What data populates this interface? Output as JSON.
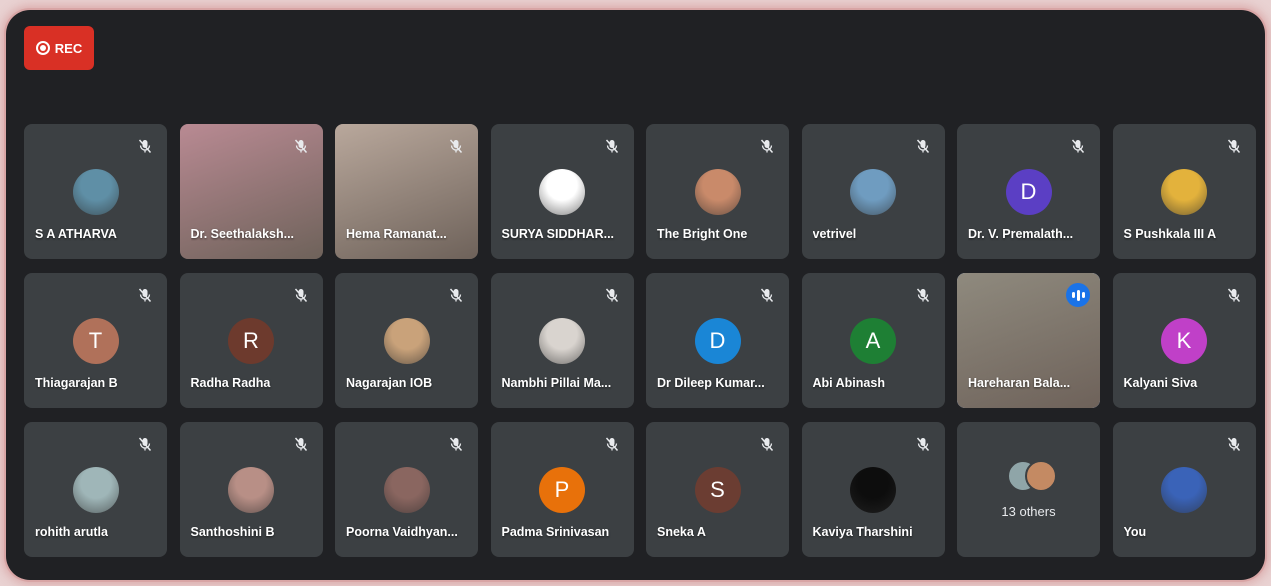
{
  "recording": {
    "label": "REC"
  },
  "participants": [
    {
      "name": "S A ATHARVA",
      "kind": "photo",
      "bg": "#5f8fa6"
    },
    {
      "name": "Dr. Seethalaksh...",
      "kind": "video",
      "bg": "#b98a93"
    },
    {
      "name": "Hema Ramanat...",
      "kind": "video",
      "bg": "#b9a89c"
    },
    {
      "name": "SURYA SIDDHAR...",
      "kind": "photo",
      "bg": "#ffffff"
    },
    {
      "name": "The Bright One",
      "kind": "photo",
      "bg": "#c98a6a"
    },
    {
      "name": "vetrivel",
      "kind": "photo",
      "bg": "#6f9cc0"
    },
    {
      "name": "Dr. V. Premalath...",
      "kind": "initial",
      "initial": "D",
      "bg": "#5b3fc4"
    },
    {
      "name": "S Pushkala III A",
      "kind": "photo",
      "bg": "#e3b23c"
    },
    {
      "name": "Thiagarajan B",
      "kind": "initial",
      "initial": "T",
      "bg": "#b0715a"
    },
    {
      "name": "Radha Radha",
      "kind": "initial",
      "initial": "R",
      "bg": "#6d3a2d"
    },
    {
      "name": "Nagarajan IOB",
      "kind": "photo",
      "bg": "#c9a27a"
    },
    {
      "name": "Nambhi Pillai Ma...",
      "kind": "photo",
      "bg": "#d9d4cf"
    },
    {
      "name": "Dr Dileep Kumar...",
      "kind": "initial",
      "initial": "D",
      "bg": "#1a86d6"
    },
    {
      "name": "Abi Abinash",
      "kind": "initial",
      "initial": "A",
      "bg": "#1e7f34"
    },
    {
      "name": "Hareharan Bala...",
      "kind": "video-speaking",
      "bg": "#8f8a7e"
    },
    {
      "name": "Kalyani Siva",
      "kind": "initial",
      "initial": "K",
      "bg": "#c040c8"
    },
    {
      "name": "rohith arutla",
      "kind": "photo",
      "bg": "#9fb6b8"
    },
    {
      "name": "Santhoshini B",
      "kind": "photo",
      "bg": "#b88f86"
    },
    {
      "name": "Poorna Vaidhyan...",
      "kind": "photo",
      "bg": "#8a6660"
    },
    {
      "name": "Padma Srinivasan",
      "kind": "initial",
      "initial": "P",
      "bg": "#e8710a"
    },
    {
      "name": "Sneka A",
      "kind": "initial",
      "initial": "S",
      "bg": "#6b3d32"
    },
    {
      "name": "Kaviya Tharshini",
      "kind": "photo",
      "bg": "#0d0d0d"
    },
    {
      "name": "13 others",
      "kind": "others"
    },
    {
      "name": "You",
      "kind": "photo",
      "bg": "#3a63b8"
    }
  ]
}
